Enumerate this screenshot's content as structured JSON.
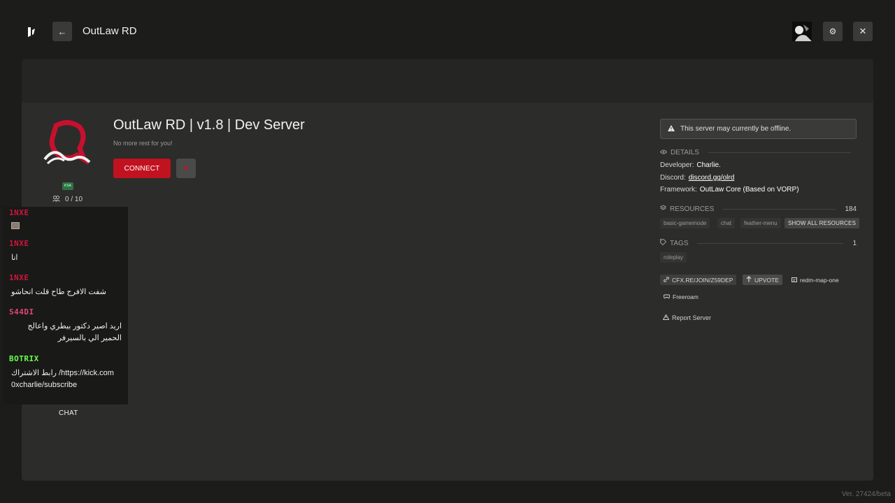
{
  "header": {
    "app_title": "OutLaw RD",
    "back_icon": "←",
    "settings_icon": "⚙",
    "close_icon": "✕"
  },
  "server": {
    "name": "OutLaw RD | v1.8 | Dev Server",
    "description": "No more rest for you!",
    "connect_label": "CONNECT",
    "favorite_icon": "♥",
    "players": "0 / 10",
    "flag_label": "KSA"
  },
  "status": {
    "offline_text": "This server may currently be offline."
  },
  "details": {
    "heading": "DETAILS",
    "developer_label": "Developer:",
    "developer_value": "Charlie.",
    "discord_label": "Discord:",
    "discord_value": "discord.gg/olrd",
    "framework_label": "Framework:",
    "framework_value": "OutLaw Core (Based on VORP)"
  },
  "resources": {
    "heading": "RESOURCES",
    "count": "184",
    "items": [
      "basic-gamemode",
      "chat",
      "feather-menu"
    ],
    "show_all_label": "SHOW ALL RESOURCES"
  },
  "tags": {
    "heading": "TAGS",
    "count": "1",
    "items": [
      "roleplay"
    ]
  },
  "links": {
    "join_url": "CFX.RE/JOIN/Z59DEP",
    "upvote": "UPVOTE",
    "map": "redm-map-one",
    "gametype": "Freeroam"
  },
  "report_label": "Report Server",
  "chat": {
    "label": "CHAT",
    "messages": [
      {
        "user": "1NXE",
        "text": ""
      },
      {
        "user": "1NXE",
        "text": "انا"
      },
      {
        "user": "1NXE",
        "text": "شفت الافرج طاح قلت انحاشو"
      },
      {
        "user": "S44DI",
        "text": "اريد اصير دكتور بيطري واعالج الحمير الي بالسيرفر"
      },
      {
        "user": "BOTRIX",
        "text": "رابط الاشتراك /https://kick.com 0xcharlie/subscribe"
      }
    ],
    "colors": {
      "1NXE": "#d0153a",
      "S44DI": "#e0457a",
      "BOTRIX": "#6bff4a"
    }
  },
  "version": "Ver. 27424/beta"
}
